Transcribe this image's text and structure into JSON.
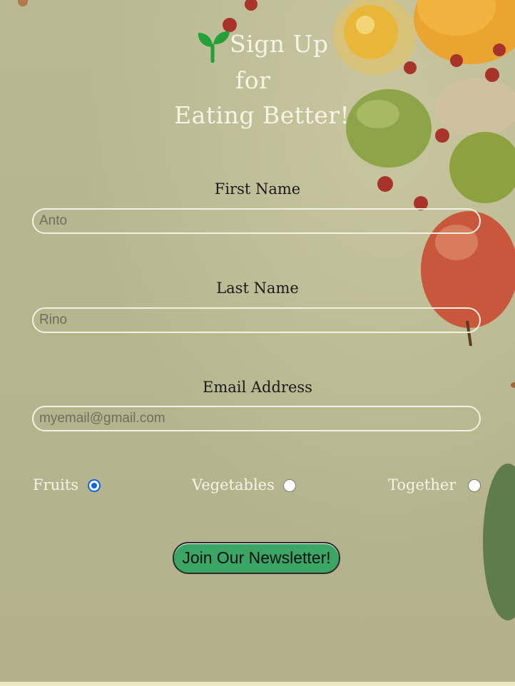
{
  "header": {
    "title_line1": "Sign Up",
    "title_line2": "for",
    "title_line3": "Eating Better!"
  },
  "form": {
    "first_name": {
      "label": "First Name",
      "placeholder": "Anto"
    },
    "last_name": {
      "label": "Last Name",
      "placeholder": "Rino"
    },
    "email": {
      "label": "Email Address",
      "placeholder": "myemail@gmail.com"
    },
    "options": [
      {
        "label": "Fruits",
        "selected": true
      },
      {
        "label": "Vegetables",
        "selected": false
      },
      {
        "label": "Together",
        "selected": false
      }
    ],
    "submit_label": "Join Our Newsletter!"
  },
  "colors": {
    "accent": "#3aa565",
    "background": "#b5b58e",
    "radio_selected": "#0a63e8"
  }
}
